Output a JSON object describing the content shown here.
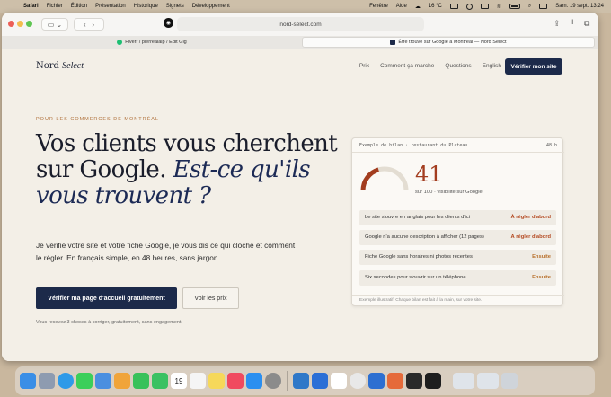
{
  "menubar": {
    "app": "Safari",
    "items": [
      "Fichier",
      "Édition",
      "Présentation",
      "Historique",
      "Signets",
      "Développement"
    ],
    "extra": [
      "Fenêtre",
      "Aide"
    ],
    "temperature": "16 °C",
    "datetime": "Sam. 19 sept.  13:24"
  },
  "browser": {
    "url": "nord-select.com",
    "tabs": [
      {
        "title": "Fiverr / pierrealaip / Edit Gig",
        "favicon_color": "#1dbf73"
      },
      {
        "title": "Être trouvé sur Google à Montréal — Nord Select",
        "favicon_color": "#1c2a4a"
      }
    ]
  },
  "site": {
    "logo_main": "Nord",
    "logo_italic": "Select",
    "nav": [
      "Prix",
      "Comment ça marche",
      "Questions",
      "English"
    ],
    "nav_cta": "Vérifier mon site",
    "eyebrow": "POUR LES COMMERCES DE MONTRÉAL",
    "headline_plain": "Vos clients vous cherchent sur Google.",
    "headline_italic": "Est-ce qu'ils vous trouvent ?",
    "lead": "Je vérifie votre site et votre fiche Google, je vous dis ce qui cloche et comment le régler. En français simple, en 48 heures, sans jargon.",
    "primary_cta": "Vérifier ma page d'accueil gratuitement",
    "secondary_cta": "Voir les prix",
    "note": "Vous recevez 3 choses à corriger, gratuitement, sans engagement."
  },
  "report_card": {
    "title": "Exemple de bilan · restaurant du Plateau",
    "turnaround": "48 h",
    "score": "41",
    "score_value": 41,
    "score_label": "sur 100 · visibilité sur Google",
    "items": [
      {
        "label": "Le site s'ouvre en anglais pour les clients d'ici",
        "priority": "À régler d'abord",
        "level": "red"
      },
      {
        "label": "Google n'a aucune description à afficher (12 pages)",
        "priority": "À régler d'abord",
        "level": "red"
      },
      {
        "label": "Fiche Google sans horaires ni photos récentes",
        "priority": "Ensuite",
        "level": "ora"
      },
      {
        "label": "Six secondes pour s'ouvrir sur un téléphone",
        "priority": "Ensuite",
        "level": "ora"
      }
    ],
    "footer": "Exemple illustratif. Chaque bilan est fait à la main, sur votre site.",
    "colors": {
      "accent": "#a33d1f",
      "gauge_track": "#e3ddd2"
    }
  },
  "dock": {
    "date_day": "19",
    "icons": [
      "finder-icon",
      "launchpad-icon",
      "safari-icon",
      "messages-icon",
      "mail-icon",
      "photos-icon",
      "facetime-icon",
      "phone-icon",
      "calendar-icon",
      "reminders-icon",
      "notes-icon",
      "music-icon",
      "app-store-icon",
      "settings-icon",
      "cyberduck-icon",
      "proton-icon",
      "slack-icon",
      "chrome-icon",
      "preview-icon",
      "claude-icon",
      "figma-icon",
      "terminal-icon",
      "window-thumb-icon",
      "window-thumb-icon",
      "trash-icon"
    ]
  }
}
